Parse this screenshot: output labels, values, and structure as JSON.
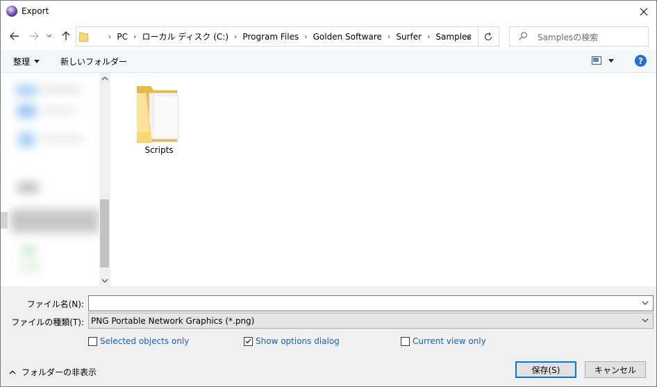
{
  "window": {
    "title": "Export"
  },
  "address": {
    "crumbs": [
      "PC",
      "ローカル ディスク (C:)",
      "Program Files",
      "Golden Software",
      "Surfer",
      "Samples"
    ]
  },
  "search": {
    "placeholder": "Samplesの検索"
  },
  "toolbar": {
    "organize": "整理",
    "new_folder": "新しいフォルダー"
  },
  "files": [
    {
      "name": "Scripts",
      "type": "folder"
    }
  ],
  "form": {
    "filename_label": "ファイル名(N):",
    "filename_value": "",
    "filetype_label": "ファイルの種類(T):",
    "filetype_value": "PNG Portable Network Graphics (*.png)"
  },
  "options": [
    {
      "label": "Selected objects only",
      "checked": false
    },
    {
      "label": "Show options dialog",
      "checked": true
    },
    {
      "label": "Current view only",
      "checked": false
    }
  ],
  "footer": {
    "hide_folders": "フォルダーの非表示",
    "save": "保存(S)",
    "cancel": "キャンセル"
  },
  "colors": {
    "accent": "#0078d7",
    "link_text": "#1f5fbf",
    "help": "#1e73d4",
    "folder": "#f8d775"
  }
}
